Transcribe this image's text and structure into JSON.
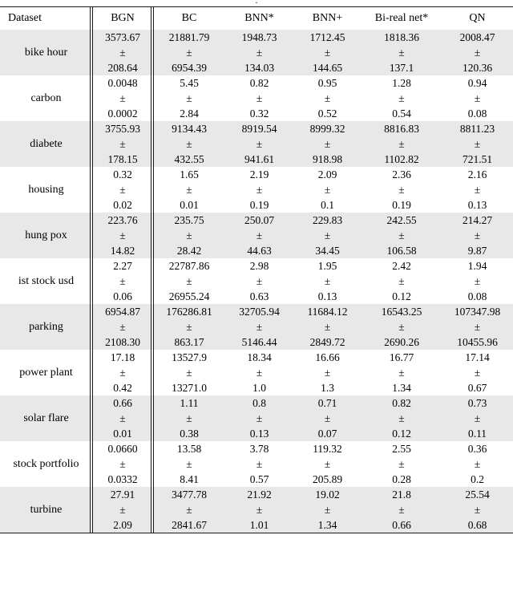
{
  "caption_fragment": ".",
  "table": {
    "columns": [
      "Dataset",
      "BGN",
      "BC",
      "BNN*",
      "BNN+",
      "Bi-real net*",
      "QN"
    ],
    "separator": "±",
    "rows": [
      {
        "dataset": "bike hour",
        "cells": [
          {
            "mean": "3573.67",
            "std": "208.64"
          },
          {
            "mean": "21881.79",
            "std": "6954.39"
          },
          {
            "mean": "1948.73",
            "std": "134.03"
          },
          {
            "mean": "1712.45",
            "std": "144.65"
          },
          {
            "mean": "1818.36",
            "std": "137.1"
          },
          {
            "mean": "2008.47",
            "std": "120.36"
          }
        ]
      },
      {
        "dataset": "carbon",
        "cells": [
          {
            "mean": "0.0048",
            "std": "0.0002"
          },
          {
            "mean": "5.45",
            "std": "2.84"
          },
          {
            "mean": "0.82",
            "std": "0.32"
          },
          {
            "mean": "0.95",
            "std": "0.52"
          },
          {
            "mean": "1.28",
            "std": "0.54"
          },
          {
            "mean": "0.94",
            "std": "0.08"
          }
        ]
      },
      {
        "dataset": "diabete",
        "cells": [
          {
            "mean": "3755.93",
            "std": "178.15"
          },
          {
            "mean": "9134.43",
            "std": "432.55"
          },
          {
            "mean": "8919.54",
            "std": "941.61"
          },
          {
            "mean": "8999.32",
            "std": "918.98"
          },
          {
            "mean": "8816.83",
            "std": "1102.82"
          },
          {
            "mean": "8811.23",
            "std": "721.51"
          }
        ]
      },
      {
        "dataset": "housing",
        "cells": [
          {
            "mean": "0.32",
            "std": "0.02"
          },
          {
            "mean": "1.65",
            "std": "0.01"
          },
          {
            "mean": "2.19",
            "std": "0.19"
          },
          {
            "mean": "2.09",
            "std": "0.1"
          },
          {
            "mean": "2.36",
            "std": "0.19"
          },
          {
            "mean": "2.16",
            "std": "0.13"
          }
        ]
      },
      {
        "dataset": "hung pox",
        "cells": [
          {
            "mean": "223.76",
            "std": "14.82"
          },
          {
            "mean": "235.75",
            "std": "28.42"
          },
          {
            "mean": "250.07",
            "std": "44.63"
          },
          {
            "mean": "229.83",
            "std": "34.45"
          },
          {
            "mean": "242.55",
            "std": "106.58"
          },
          {
            "mean": "214.27",
            "std": "9.87"
          }
        ]
      },
      {
        "dataset": "ist stock usd",
        "cells": [
          {
            "mean": "2.27",
            "std": "0.06"
          },
          {
            "mean": "22787.86",
            "std": "26955.24"
          },
          {
            "mean": "2.98",
            "std": "0.63"
          },
          {
            "mean": "1.95",
            "std": "0.13"
          },
          {
            "mean": "2.42",
            "std": "0.12"
          },
          {
            "mean": "1.94",
            "std": "0.08"
          }
        ]
      },
      {
        "dataset": "parking",
        "cells": [
          {
            "mean": "6954.87",
            "std": "2108.30"
          },
          {
            "mean": "176286.81",
            "std": "863.17"
          },
          {
            "mean": "32705.94",
            "std": "5146.44"
          },
          {
            "mean": "11684.12",
            "std": "2849.72"
          },
          {
            "mean": "16543.25",
            "std": "2690.26"
          },
          {
            "mean": "107347.98",
            "std": "10455.96"
          }
        ]
      },
      {
        "dataset": "power plant",
        "cells": [
          {
            "mean": "17.18",
            "std": "0.42"
          },
          {
            "mean": "13527.9",
            "std": "13271.0"
          },
          {
            "mean": "18.34",
            "std": "1.0"
          },
          {
            "mean": "16.66",
            "std": "1.3"
          },
          {
            "mean": "16.77",
            "std": "1.34"
          },
          {
            "mean": "17.14",
            "std": "0.67"
          }
        ]
      },
      {
        "dataset": "solar flare",
        "cells": [
          {
            "mean": "0.66",
            "std": "0.01"
          },
          {
            "mean": "1.11",
            "std": "0.38"
          },
          {
            "mean": "0.8",
            "std": "0.13"
          },
          {
            "mean": "0.71",
            "std": "0.07"
          },
          {
            "mean": "0.82",
            "std": "0.12"
          },
          {
            "mean": "0.73",
            "std": "0.11"
          }
        ]
      },
      {
        "dataset": "stock portfolio",
        "cells": [
          {
            "mean": "0.0660",
            "std": "0.0332"
          },
          {
            "mean": "13.58",
            "std": "8.41"
          },
          {
            "mean": "3.78",
            "std": "0.57"
          },
          {
            "mean": "119.32",
            "std": "205.89"
          },
          {
            "mean": "2.55",
            "std": "0.28"
          },
          {
            "mean": "0.36",
            "std": "0.2"
          }
        ]
      },
      {
        "dataset": "turbine",
        "cells": [
          {
            "mean": "27.91",
            "std": "2.09"
          },
          {
            "mean": "3477.78",
            "std": "2841.67"
          },
          {
            "mean": "21.92",
            "std": "1.01"
          },
          {
            "mean": "19.02",
            "std": "1.34"
          },
          {
            "mean": "21.8",
            "std": "0.66"
          },
          {
            "mean": "25.54",
            "std": "0.68"
          }
        ]
      }
    ]
  },
  "style": {
    "shaded_row_bg": "#e8e8e8",
    "plain_row_bg": "#ffffff",
    "rule_color": "#1a1a1a"
  }
}
